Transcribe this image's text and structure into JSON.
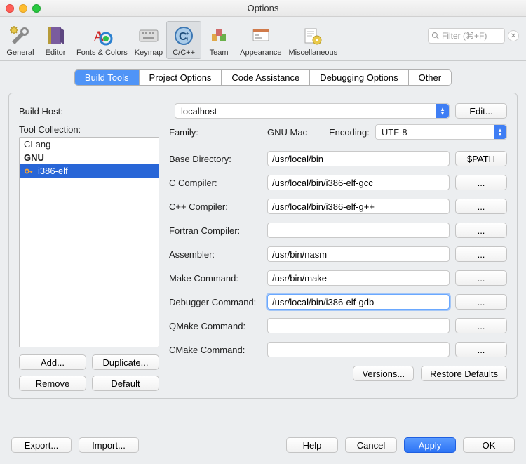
{
  "window": {
    "title": "Options"
  },
  "toolbar": {
    "items": [
      {
        "label": "General"
      },
      {
        "label": "Editor"
      },
      {
        "label": "Fonts & Colors"
      },
      {
        "label": "Keymap"
      },
      {
        "label": "C/C++"
      },
      {
        "label": "Team"
      },
      {
        "label": "Appearance"
      },
      {
        "label": "Miscellaneous"
      }
    ],
    "search_placeholder": "Filter (⌘+F)"
  },
  "tabs": [
    "Build Tools",
    "Project Options",
    "Code Assistance",
    "Debugging Options",
    "Other"
  ],
  "build_host": {
    "label": "Build Host:",
    "value": "localhost",
    "edit_label": "Edit..."
  },
  "tool_collection": {
    "label": "Tool Collection:",
    "items": [
      {
        "name": "CLang"
      },
      {
        "name": "GNU"
      },
      {
        "name": "i386-elf"
      }
    ],
    "buttons": {
      "add": "Add...",
      "duplicate": "Duplicate...",
      "remove": "Remove",
      "default": "Default"
    }
  },
  "details": {
    "family_label": "Family:",
    "family_value": "GNU Mac",
    "encoding_label": "Encoding:",
    "encoding_value": "UTF-8",
    "rows": [
      {
        "label": "Base Directory:",
        "value": "/usr/local/bin",
        "button": "$PATH"
      },
      {
        "label": "C Compiler:",
        "value": "/usr/local/bin/i386-elf-gcc",
        "button": "..."
      },
      {
        "label": "C++ Compiler:",
        "value": "/usr/local/bin/i386-elf-g++",
        "button": "..."
      },
      {
        "label": "Fortran Compiler:",
        "value": "",
        "button": "..."
      },
      {
        "label": "Assembler:",
        "value": "/usr/bin/nasm",
        "button": "..."
      },
      {
        "label": "Make Command:",
        "value": "/usr/bin/make",
        "button": "..."
      },
      {
        "label": "Debugger Command:",
        "value": "/usr/local/bin/i386-elf-gdb",
        "button": "...",
        "focus": true
      },
      {
        "label": "QMake Command:",
        "value": "",
        "button": "..."
      },
      {
        "label": "CMake Command:",
        "value": "",
        "button": "..."
      }
    ],
    "versions": "Versions...",
    "restore": "Restore Defaults"
  },
  "footer": {
    "export": "Export...",
    "import": "Import...",
    "help": "Help",
    "cancel": "Cancel",
    "apply": "Apply",
    "ok": "OK"
  }
}
